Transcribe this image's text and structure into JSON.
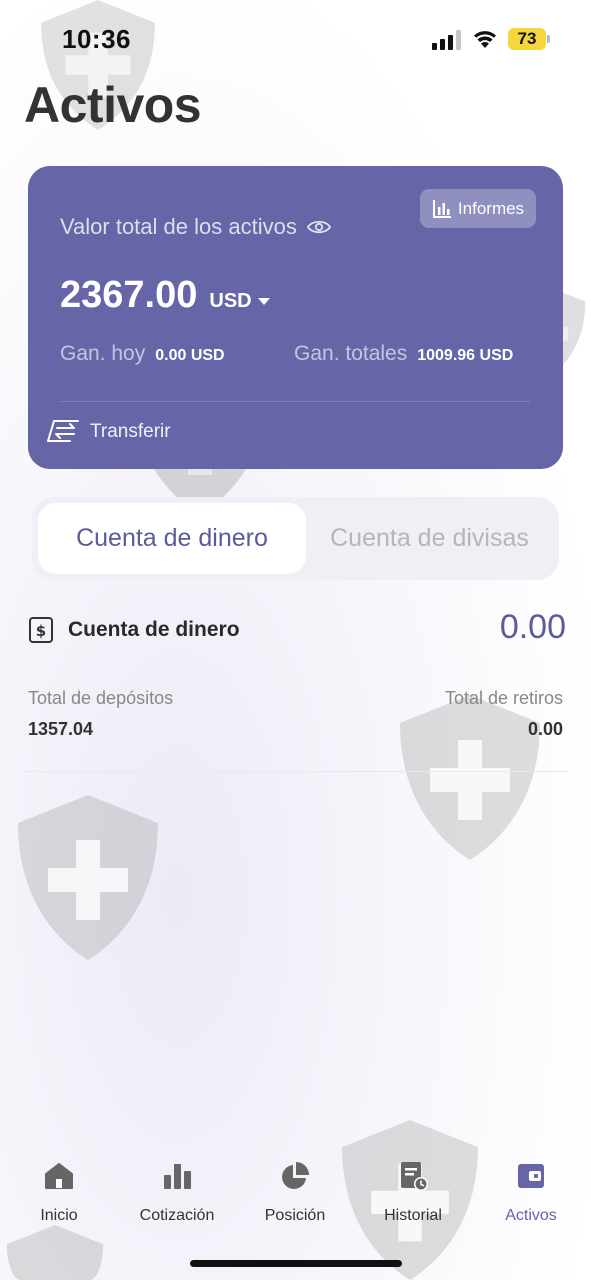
{
  "status": {
    "time": "10:36",
    "battery": "73"
  },
  "page": {
    "title": "Activos"
  },
  "summary": {
    "reports_label": "Informes",
    "total_label": "Valor total de los activos",
    "total_value": "2367.00",
    "currency": "USD",
    "today_gain_label": "Gan. hoy",
    "today_gain_value": "0.00 USD",
    "total_gain_label": "Gan. totales",
    "total_gain_value": "1009.96 USD",
    "transfer_label": "Transferir"
  },
  "tabs": {
    "active": "Cuenta de dinero",
    "inactive": "Cuenta de divisas"
  },
  "account": {
    "title": "Cuenta de dinero",
    "balance": "0.00",
    "deposits_label": "Total de depósitos",
    "deposits_value": "1357.04",
    "withdrawals_label": "Total de retiros",
    "withdrawals_value": "0.00"
  },
  "nav": {
    "items": [
      {
        "label": "Inicio",
        "icon": "home-icon"
      },
      {
        "label": "Cotización",
        "icon": "bar-chart-icon"
      },
      {
        "label": "Posición",
        "icon": "pie-chart-icon"
      },
      {
        "label": "Historial",
        "icon": "history-icon"
      },
      {
        "label": "Activos",
        "icon": "wallet-icon"
      }
    ],
    "active_index": 4
  },
  "colors": {
    "accent": "#6565a8",
    "battery": "#f5d63b"
  }
}
